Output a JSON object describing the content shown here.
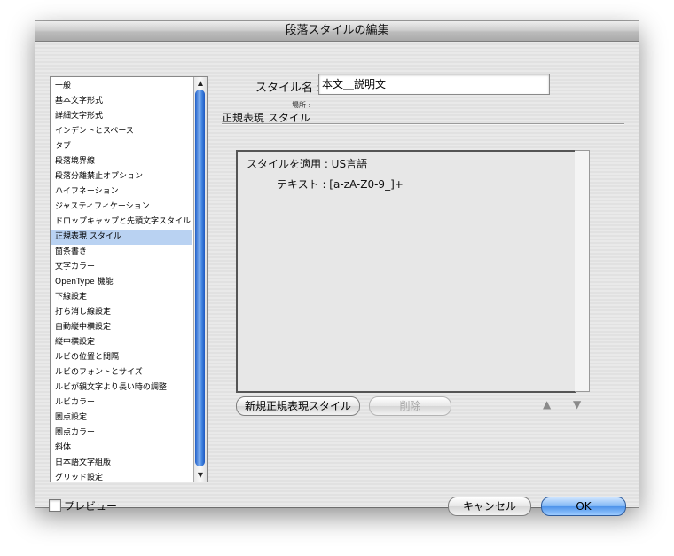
{
  "window": {
    "title": "段落スタイルの編集"
  },
  "sidebar": {
    "items": [
      "一般",
      "基本文字形式",
      "詳細文字形式",
      "インデントとスペース",
      "タブ",
      "段落境界線",
      "段落分離禁止オプション",
      "ハイフネーション",
      "ジャスティフィケーション",
      "ドロップキャップと先頭文字スタイル",
      "正規表現 スタイル",
      "箇条書き",
      "文字カラー",
      "OpenType 機能",
      "下線設定",
      "打ち消し線設定",
      "自動縦中横設定",
      "縦中横設定",
      "ルビの位置と間隔",
      "ルビのフォントとサイズ",
      "ルビが親文字より長い時の調整",
      "ルビカラー",
      "圏点設定",
      "圏点カラー",
      "斜体",
      "日本語文字組版",
      "グリッド設定"
    ],
    "selected_index": 10
  },
  "main": {
    "style_name_label": "スタイル名 :",
    "style_name_value": "本文＿説明文",
    "location_label": "場所 :",
    "section_title": "正規表現 スタイル",
    "regex_rows": [
      {
        "text": "スタイルを適用 : US言語"
      },
      {
        "text": "テキスト : [a-zA-Z0-9_]+"
      }
    ],
    "new_button": "新規正規表現スタイル",
    "delete_button": "削除",
    "move_up_symbol": "▲",
    "move_down_symbol": "▼"
  },
  "footer": {
    "preview_label": "プレビュー",
    "preview_checked": false,
    "cancel_button": "キャンセル",
    "ok_button": "OK"
  },
  "colors": {
    "selection": "#b9d2f2",
    "scroll_thumb": "#3f82e0",
    "default_button": "#4d93ea"
  },
  "icons": {
    "scroll_up": "scroll-up-arrow-icon",
    "scroll_down": "scroll-down-arrow-icon",
    "move_up": "triangle-up-icon",
    "move_down": "triangle-down-icon"
  }
}
